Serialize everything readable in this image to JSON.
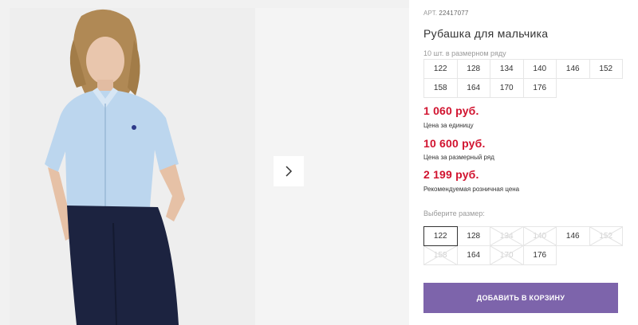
{
  "product": {
    "article_label": "АРТ.",
    "article_number": "22417077",
    "title": "Рубашка для мальчика"
  },
  "size_range": {
    "note": "10 шт. в размерном ряду",
    "sizes": [
      "122",
      "128",
      "134",
      "140",
      "146",
      "152",
      "158",
      "164",
      "170",
      "176"
    ]
  },
  "prices": [
    {
      "value": "1 060 руб.",
      "label": "Цена за единицу"
    },
    {
      "value": "10 600 руб.",
      "label": "Цена за размерный ряд"
    },
    {
      "value": "2 199 руб.",
      "label": "Рекомендуемая розничная цена"
    }
  ],
  "size_picker": {
    "label": "Выберите размер:",
    "selected": "122",
    "options": [
      {
        "size": "122",
        "available": true
      },
      {
        "size": "128",
        "available": true
      },
      {
        "size": "134",
        "available": false
      },
      {
        "size": "140",
        "available": false
      },
      {
        "size": "146",
        "available": true
      },
      {
        "size": "152",
        "available": false
      },
      {
        "size": "158",
        "available": false
      },
      {
        "size": "164",
        "available": true
      },
      {
        "size": "170",
        "available": false
      },
      {
        "size": "176",
        "available": true
      }
    ]
  },
  "cart_button": "ДОБАВИТЬ В КОРЗИНУ",
  "colors": {
    "price": "#d1132f",
    "cart_button_bg": "#7d64ab"
  },
  "gallery": {
    "next_icon": "chevron-right-icon"
  }
}
